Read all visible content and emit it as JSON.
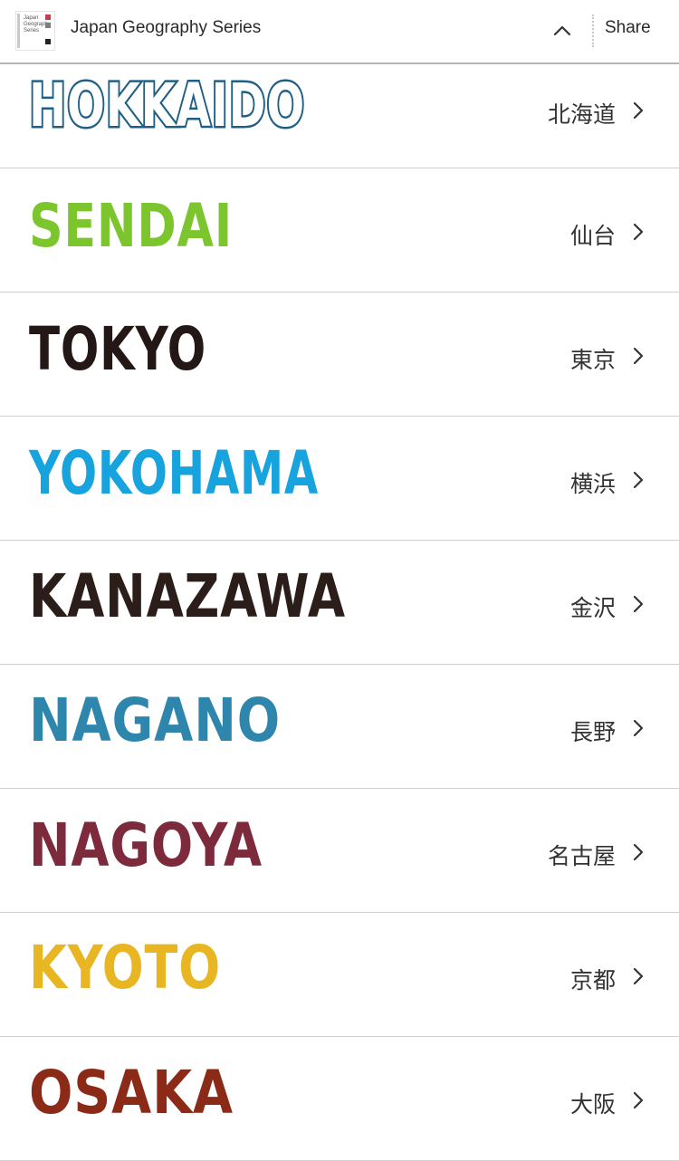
{
  "header": {
    "title": "Japan Geography Series",
    "thumbnail_text": [
      "Japan",
      "Geography",
      "Series"
    ],
    "share_label": "Share",
    "collapse_icon": "chevron-up-icon"
  },
  "items": [
    {
      "logo": "HOKKAIDO",
      "kanji": "北海道",
      "color": "#1f5f86",
      "style": "outline"
    },
    {
      "logo": "SENDAI",
      "kanji": "仙台",
      "color": "#7cc52e",
      "style": "solid"
    },
    {
      "logo": "TOKYO",
      "kanji": "東京",
      "color": "#231815",
      "style": "solid"
    },
    {
      "logo": "YOKOHAMA",
      "kanji": "横浜",
      "color": "#17a3de",
      "style": "solid"
    },
    {
      "logo": "KANAZAWA",
      "kanji": "金沢",
      "color": "#2b1d1a",
      "style": "solid"
    },
    {
      "logo": "NAGANO",
      "kanji": "長野",
      "color": "#2f86ad",
      "style": "solid"
    },
    {
      "logo": "NAGOYA",
      "kanji": "名古屋",
      "color": "#7d2a3d",
      "style": "solid"
    },
    {
      "logo": "KYOTO",
      "kanji": "京都",
      "color": "#e8b523",
      "style": "solid"
    },
    {
      "logo": "OSAKA",
      "kanji": "大阪",
      "color": "#8b2a17",
      "style": "solid"
    }
  ]
}
